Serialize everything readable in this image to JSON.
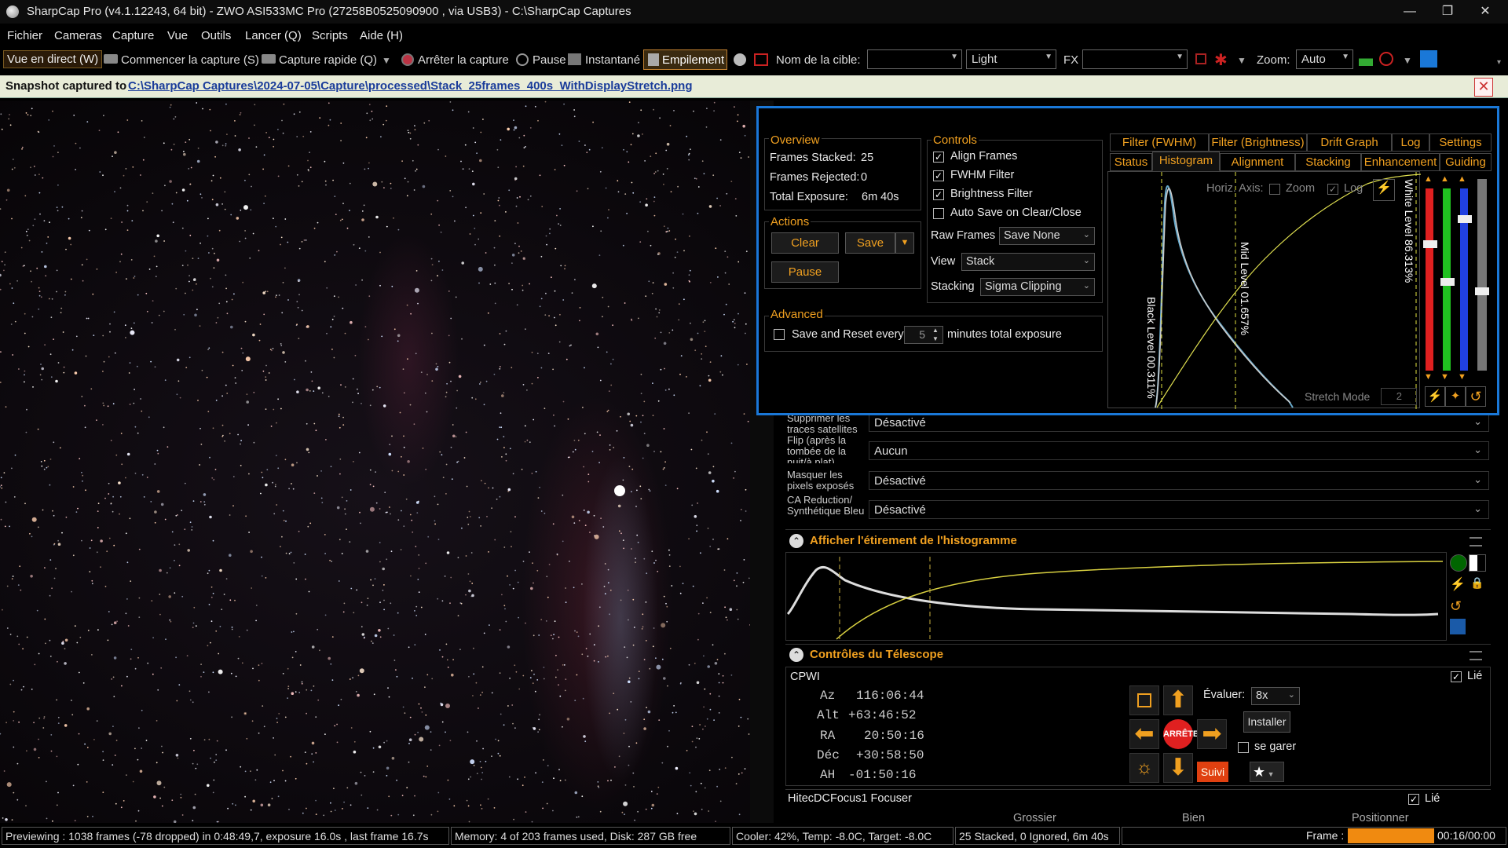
{
  "window": {
    "title": "SharpCap Pro (v4.1.12243, 64 bit) - ZWO ASI533MC Pro (27258B0525090900 , via USB3) - C:\\SharpCap Captures",
    "minimize": "—",
    "maximize": "❐",
    "close": "✕"
  },
  "menu": [
    "Fichier",
    "Cameras",
    "Capture",
    "Vue",
    "Outils",
    "Lancer (Q)",
    "Scripts",
    "Aide (H)"
  ],
  "toolbar": {
    "live_view": "Vue en direct (W)",
    "start_capture": "Commencer la capture (S)",
    "quick_capture": "Capture rapide (Q)",
    "stop_capture": "Arrêter la capture",
    "pause": "Pause",
    "snapshot": "Instantané",
    "stacking": "Empilement",
    "target_label": "Nom de la cible:",
    "target_value": "",
    "frame_type": "Light",
    "fx_label": "FX",
    "fx_value": "",
    "zoom_label": "Zoom:",
    "zoom_value": "Auto"
  },
  "notification": {
    "label": "Snapshot captured to",
    "path": "C:\\SharpCap Captures\\2024-07-05\\Capture\\processed\\Stack_25frames_400s_WithDisplayStretch.png"
  },
  "settings_rows": [
    {
      "label": "Supprimer les traces satellites",
      "value": "Désactivé"
    },
    {
      "label": "Flip (après la tombée de la nuit/à plat)",
      "value": "Aucun"
    },
    {
      "label": "Masquer les pixels exposés",
      "value": "Désactivé"
    },
    {
      "label": "CA Reduction/ Synthétique Bleu",
      "value": "Désactivé"
    }
  ],
  "histogram_section": {
    "title": "Afficher l'étirement de l'histogramme"
  },
  "telescope": {
    "title": "Contrôles du Télescope",
    "mount": "CPWI",
    "linked": "Lié",
    "coords": [
      {
        "label": "Az",
        "value": "116:06:44"
      },
      {
        "label": "Alt",
        "value": "+63:46:52"
      },
      {
        "label": "RA",
        "value": "20:50:16"
      },
      {
        "label": "Déc",
        "value": "+30:58:50"
      },
      {
        "label": "AH",
        "value": "-01:50:16"
      }
    ],
    "stop": "ARRÊTE",
    "evaluate_label": "Évaluer:",
    "rate": "8x",
    "install": "Installer",
    "park": "se garer",
    "track": "Suivi"
  },
  "focuser": {
    "name": "HitecDCFocus1 Focuser",
    "linked": "Lié",
    "coarse": "Grossier",
    "fine": "Bien",
    "position": "Positionner"
  },
  "stacking": {
    "overview_title": "Overview",
    "frames_stacked_label": "Frames Stacked:",
    "frames_stacked": "25",
    "frames_rejected_label": "Frames Rejected:",
    "frames_rejected": "0",
    "total_exposure_label": "Total Exposure:",
    "total_exposure": "6m 40s",
    "actions_title": "Actions",
    "clear": "Clear",
    "save": "Save",
    "pause": "Pause",
    "advanced_title": "Advanced",
    "save_reset_label": "Save and Reset every",
    "save_reset_value": "5",
    "save_reset_suffix": "minutes total exposure",
    "controls_title": "Controls",
    "align": "Align Frames",
    "fwhm": "FWHM Filter",
    "brightness": "Brightness Filter",
    "autosave": "Auto Save on Clear/Close",
    "raw_frames_label": "Raw Frames",
    "raw_frames": "Save None",
    "view_label": "View",
    "view": "Stack",
    "stacking_label": "Stacking",
    "stacking_mode": "Sigma Clipping",
    "tabs_top": [
      "Filter (FWHM)",
      "Filter (Brightness)",
      "Drift Graph",
      "Log",
      "Settings"
    ],
    "tabs_bottom": [
      "Status",
      "Histogram",
      "Alignment",
      "Stacking",
      "Enhancement",
      "Guiding"
    ],
    "hist_axis": "Horiz. Axis:",
    "hist_zoom": "Zoom",
    "hist_log": "Log",
    "black_level": "Black Level 00.311%",
    "mid_level": "Mid Level 01.657%",
    "white_level": "White Level 86.313%",
    "stretch_mode_label": "Stretch Mode",
    "stretch_mode": "2"
  },
  "status": {
    "preview": "Previewing : 1038 frames (-78 dropped) in 0:48:49,7, exposure 16.0s , last frame 16.7s",
    "memory": "Memory: 4 of 203 frames used, Disk: 287 GB free",
    "cooler": "Cooler: 42%, Temp: -8.0C, Target: -8.0C",
    "stacked": "25 Stacked, 0 Ignored, 6m 40s",
    "frame_label": "Frame :",
    "frame_time": "00:16/00:00"
  },
  "colors": {
    "accent": "#f0a020",
    "highlight": "#1a78d8",
    "frame_progress": "#f08a10"
  }
}
